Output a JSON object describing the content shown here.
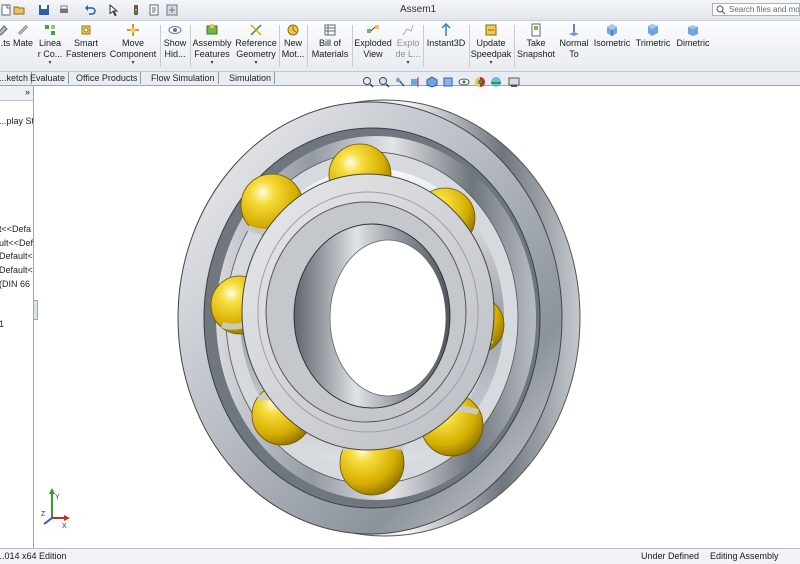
{
  "window": {
    "title": "Assem1",
    "search_placeholder": "Search files and models"
  },
  "ribbon": {
    "buttons": [
      {
        "label": "...ts",
        "icon": "insert-components-icon"
      },
      {
        "label": "Mate",
        "icon": "mate-icon"
      },
      {
        "label": "Linea\nr Co...",
        "icon": "linear-pattern-icon"
      },
      {
        "label": "Smart\nFasteners",
        "icon": "smart-fasteners-icon"
      },
      {
        "label": "Move\nComponent",
        "icon": "move-component-icon"
      },
      {
        "label": "Show\nHid...",
        "icon": "show-hidden-icon"
      },
      {
        "label": "Assembly\nFeatures",
        "icon": "assembly-features-icon"
      },
      {
        "label": "Reference\nGeometry",
        "icon": "reference-geometry-icon"
      },
      {
        "label": "New\nMot...",
        "icon": "new-motion-study-icon"
      },
      {
        "label": "Bill of\nMaterials",
        "icon": "bill-of-materials-icon"
      },
      {
        "label": "Exploded\nView",
        "icon": "exploded-view-icon"
      },
      {
        "label": "Explo\nde L...",
        "icon": "explode-line-sketch-icon"
      },
      {
        "label": "Instant3D",
        "icon": "instant3d-icon"
      },
      {
        "label": "Update\nSpeedpak",
        "icon": "update-speedpak-icon"
      },
      {
        "label": "Take\nSnapshot",
        "icon": "snapshot-icon"
      },
      {
        "label": "Normal\nTo",
        "icon": "normal-to-icon"
      },
      {
        "label": "Isometric",
        "icon": "isometric-cube-icon"
      },
      {
        "label": "Trimetric",
        "icon": "trimetric-cube-icon"
      },
      {
        "label": "Dimetric",
        "icon": "dimetric-cube-icon"
      }
    ]
  },
  "tabs": [
    "...ketch",
    "Evaluate",
    "Office Products",
    "Flow Simulation",
    "Simulation"
  ],
  "feature_manager": {
    "rows": [
      "...play Sta",
      "t<<Defa",
      "ult<<Def",
      "Default<",
      "Default<",
      "(DIN 66",
      "1"
    ]
  },
  "status": {
    "edition": "...014 x64 Edition",
    "state": "Under Defined",
    "mode": "Editing Assembly"
  },
  "colors": {
    "ball_yellow": "#e7c300",
    "steel": "#a9aeb5",
    "ribbon_bg": "#eef1f5"
  }
}
